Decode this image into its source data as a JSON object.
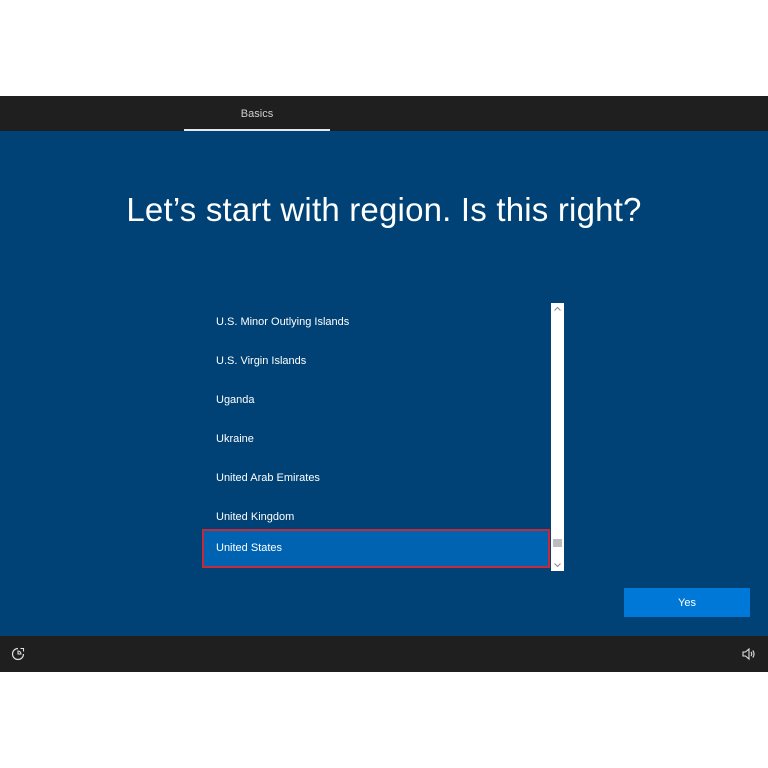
{
  "header": {
    "tabs": [
      {
        "label": "Basics",
        "active": true
      }
    ]
  },
  "main": {
    "title": "Let’s start with region. Is this right?",
    "region_list": {
      "items": [
        {
          "label": "U.S. Minor Outlying Islands",
          "selected": false
        },
        {
          "label": "U.S. Virgin Islands",
          "selected": false
        },
        {
          "label": "Uganda",
          "selected": false
        },
        {
          "label": "Ukraine",
          "selected": false
        },
        {
          "label": "United Arab Emirates",
          "selected": false
        },
        {
          "label": "United Kingdom",
          "selected": false
        },
        {
          "label": "United States",
          "selected": true
        }
      ]
    },
    "yes_button": "Yes"
  },
  "footer": {
    "left_icon": "ease-of-access-icon",
    "right_icon": "volume-icon"
  },
  "colors": {
    "background": "#004275",
    "bar": "#1f1f1f",
    "accent": "#0078d7",
    "selection": "#0063b1",
    "highlight_border": "#c42b3a"
  }
}
